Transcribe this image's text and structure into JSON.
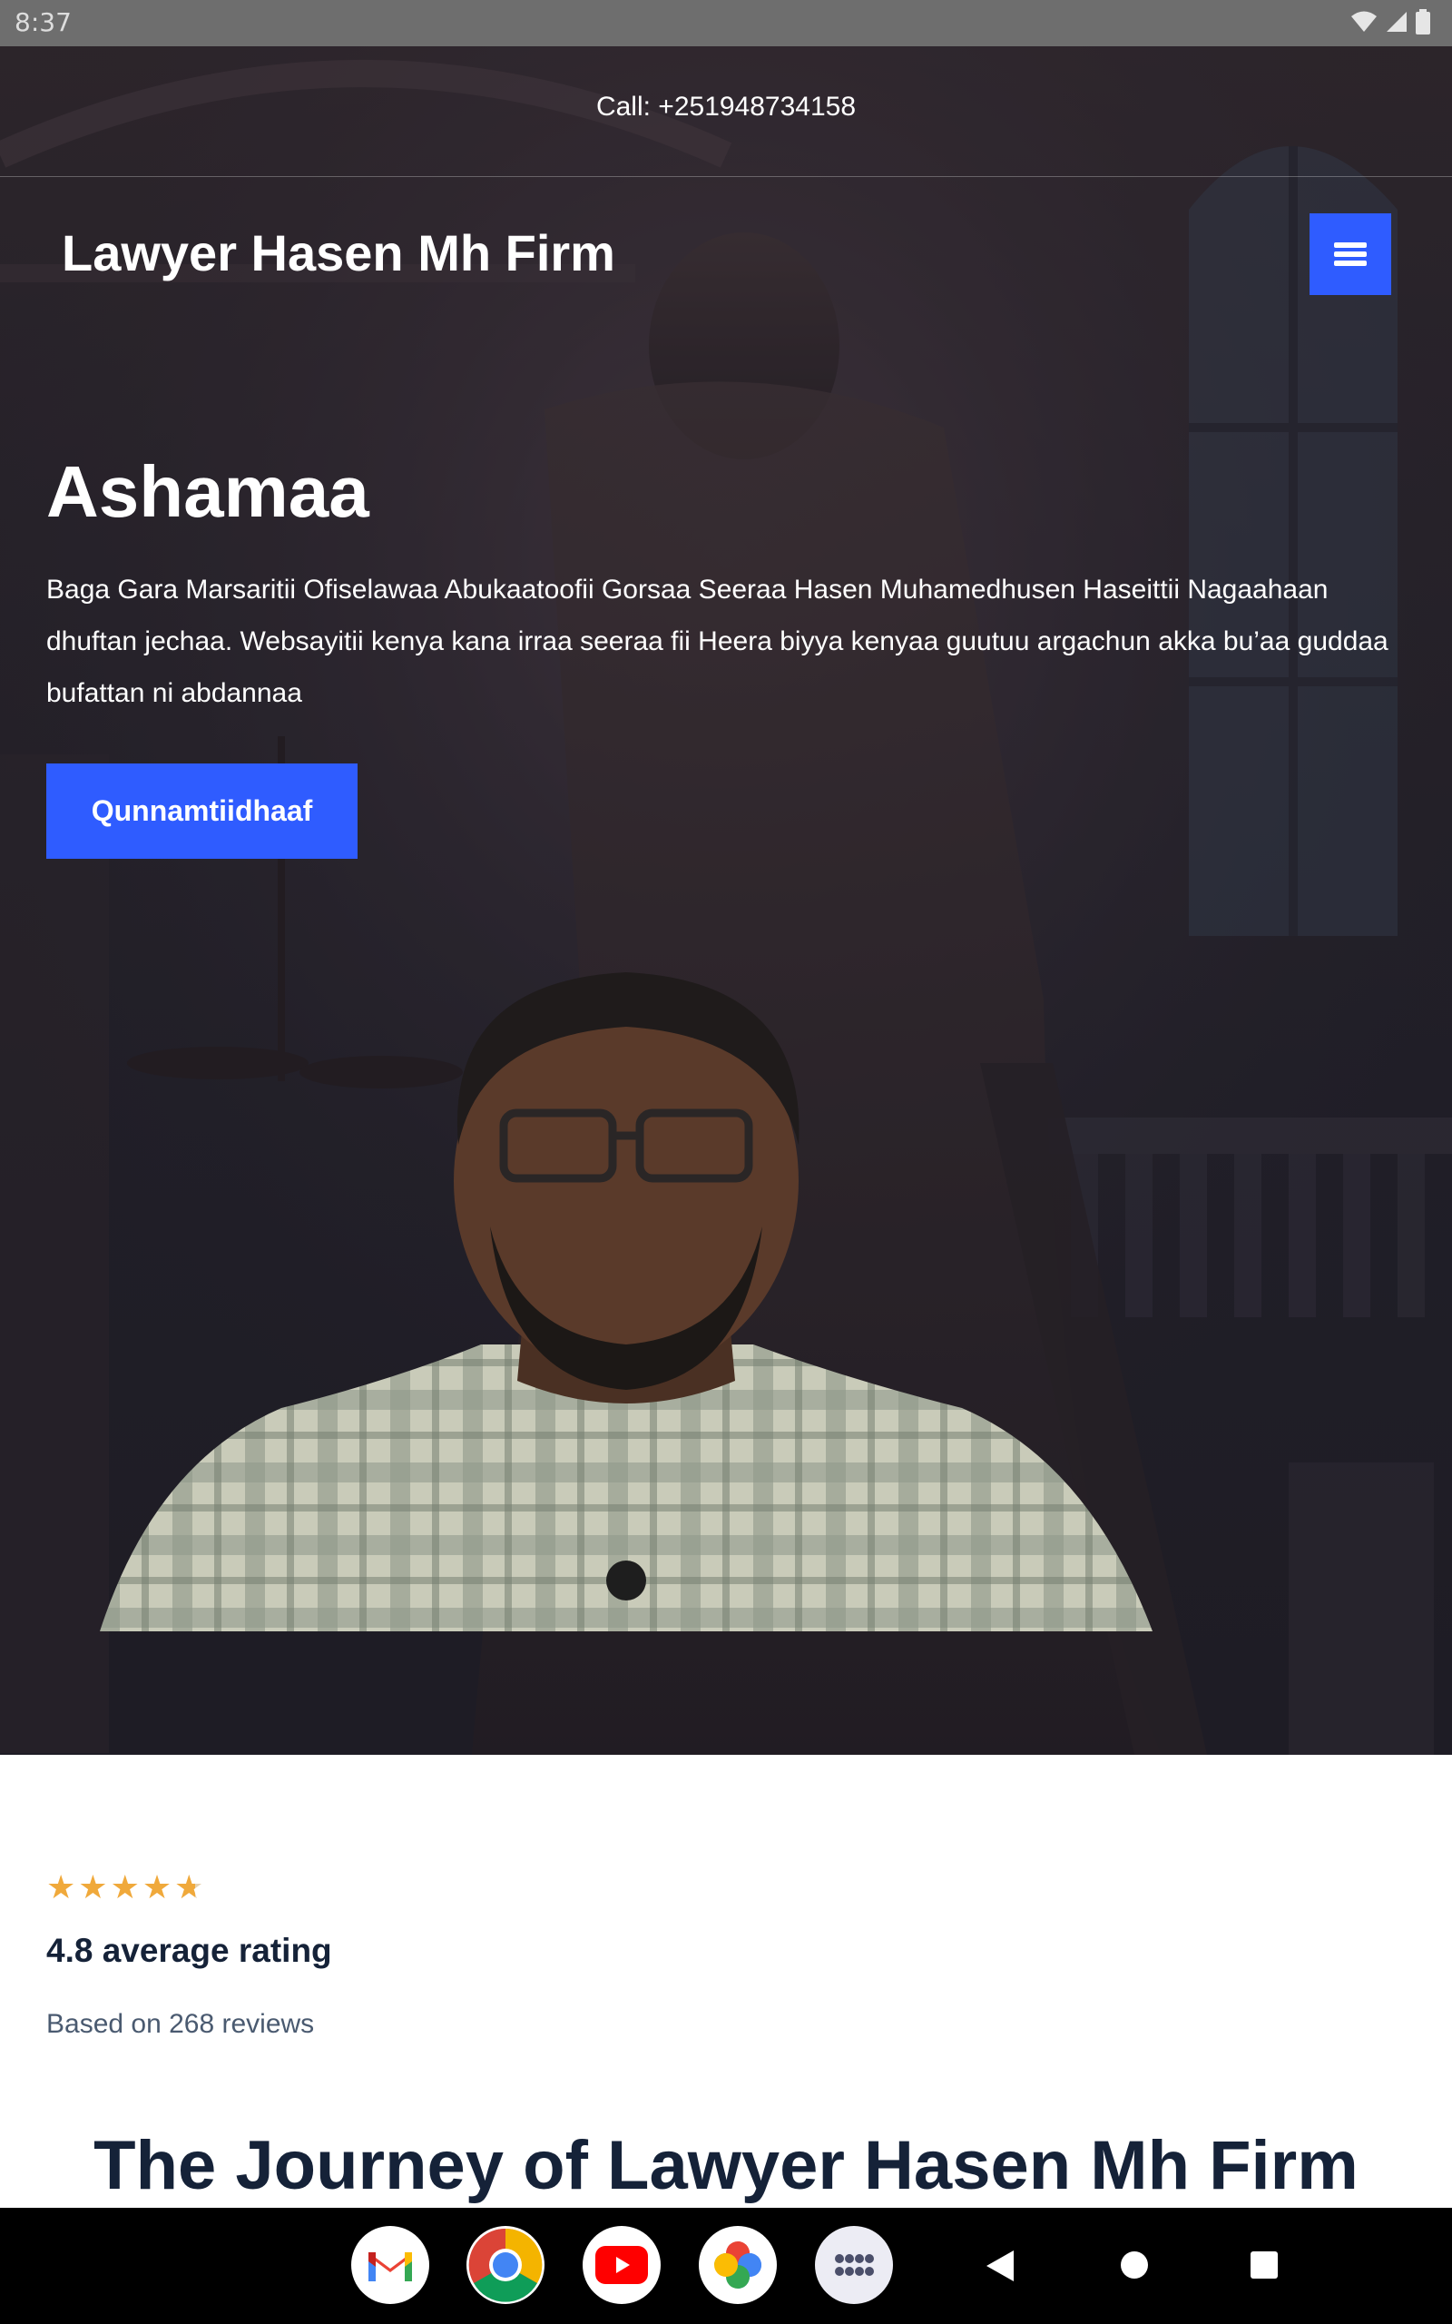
{
  "status_bar": {
    "time": "8:37",
    "icons": [
      "wifi-icon",
      "signal-icon",
      "battery-icon"
    ]
  },
  "topbar": {
    "call_text": "Call: +251948734158"
  },
  "header": {
    "brand": "Lawyer Hasen Mh Firm",
    "menu_icon": "hamburger-menu-icon"
  },
  "hero": {
    "title": "Ashamaa",
    "description": "Baga Gara Marsaritii Ofiselawaa Abukaatoofii Gorsaa Seeraa Hasen Muhamedhusen Haseittii Nagaahaan dhuftan jechaa. Websayitii kenya kana irraa seeraa fii Heera biyya kenyaa guutuu argachun akka bu’aa guddaa bufattan ni abdannaa",
    "cta_label": "Qunnamtiidhaaf"
  },
  "rating": {
    "stars_value": 4.8,
    "stars_max": 5,
    "title": "4.8 average rating",
    "subtitle": "Based on 268 reviews"
  },
  "section": {
    "title": "The Journey of Lawyer Hasen Mh Firm"
  },
  "nav": {
    "apps": [
      "gmail-icon",
      "chrome-icon",
      "youtube-icon",
      "photos-icon",
      "app-drawer-icon"
    ],
    "system": [
      "back-icon",
      "home-icon",
      "recents-icon"
    ]
  },
  "colors": {
    "accent": "#2f5cff",
    "star": "#f0a93b",
    "heading": "#152238",
    "muted": "#4a5a70"
  }
}
